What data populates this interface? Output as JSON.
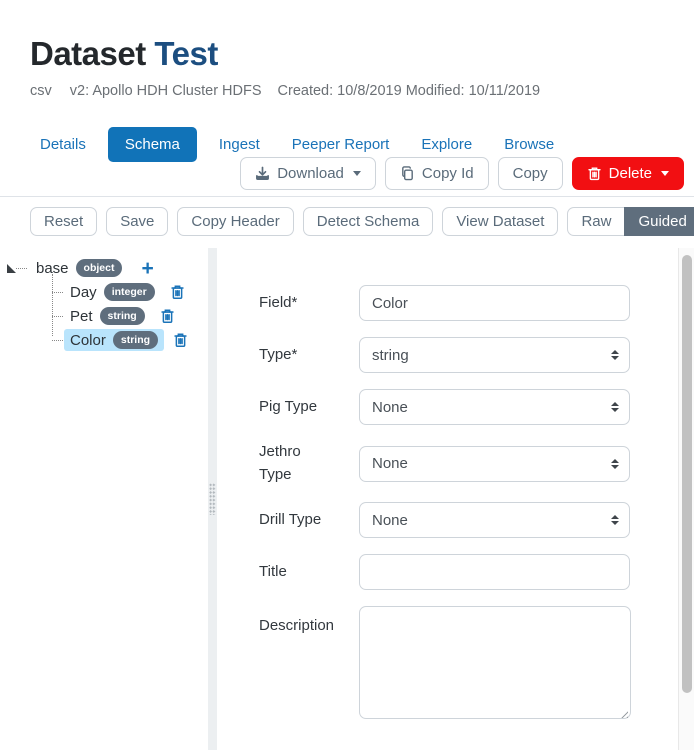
{
  "colors": {
    "accent_blue": "#1a73b8",
    "active_tab": "#1173b8",
    "danger_red": "#f20f12",
    "slate": "#5a6b7a",
    "badge_slate": "#5f6e7d",
    "selection_blue": "#b9e4fc",
    "title_navy": "#1c4e80"
  },
  "header": {
    "title_primary": "Dataset",
    "title_secondary": "Test",
    "format": "csv",
    "version": "v2: Apollo HDH Cluster HDFS",
    "dates": "Created: 10/8/2019 Modified: 10/11/2019"
  },
  "tabs": {
    "items": [
      {
        "label": "Details",
        "active": false
      },
      {
        "label": "Schema",
        "active": true
      },
      {
        "label": "Ingest",
        "active": false
      },
      {
        "label": "Peeper Report",
        "active": false
      },
      {
        "label": "Explore",
        "active": false
      },
      {
        "label": "Browse",
        "active": false
      }
    ]
  },
  "actions": {
    "download": "Download",
    "copy_id": "Copy Id",
    "copy": "Copy",
    "delete": "Delete"
  },
  "toolbar": {
    "reset": "Reset",
    "save": "Save",
    "copy_header": "Copy Header",
    "detect_schema": "Detect Schema",
    "view_dataset": "View Dataset",
    "raw": "Raw",
    "guided": "Guided",
    "active_mode": "Guided"
  },
  "tree": {
    "root": {
      "label": "base",
      "type": "object"
    },
    "nodes": [
      {
        "label": "Day",
        "type": "integer",
        "selected": false
      },
      {
        "label": "Pet",
        "type": "string",
        "selected": false
      },
      {
        "label": "Color",
        "type": "string",
        "selected": true
      }
    ]
  },
  "form": {
    "fields": [
      {
        "label": "Field*",
        "control": "text",
        "value": "Color"
      },
      {
        "label": "Type*",
        "control": "select",
        "value": "string"
      },
      {
        "label": "Pig Type",
        "control": "select",
        "value": "None"
      },
      {
        "label": "Jethro Type",
        "control": "select",
        "value": "None"
      },
      {
        "label": "Drill Type",
        "control": "select",
        "value": "None"
      },
      {
        "label": "Title",
        "control": "text",
        "value": ""
      },
      {
        "label": "Description",
        "control": "textarea",
        "value": ""
      }
    ]
  }
}
